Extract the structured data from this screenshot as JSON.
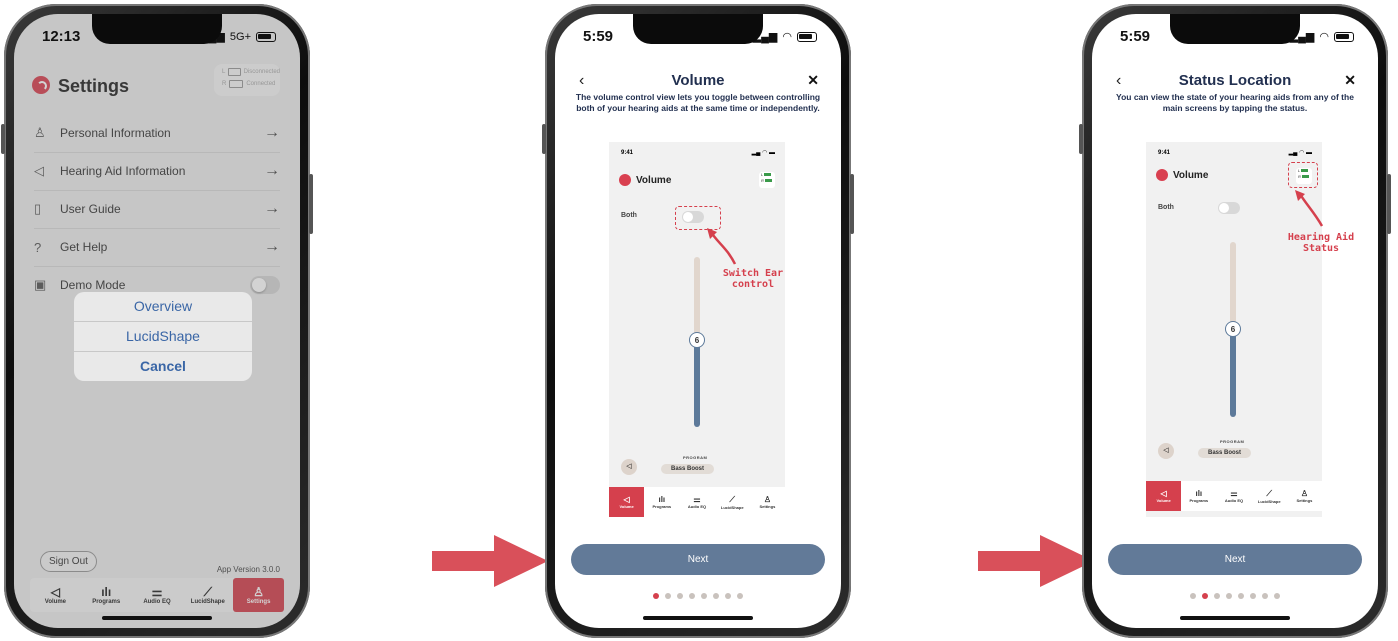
{
  "phone1": {
    "time": "12:13",
    "signal": "5G+",
    "title": "Settings",
    "connection": {
      "left": "L",
      "left_status": "Disconnected",
      "right": "R",
      "right_status": "Connected"
    },
    "menu": [
      {
        "icon": "person-icon",
        "label": "Personal Information"
      },
      {
        "icon": "speaker-icon",
        "label": "Hearing Aid Information"
      },
      {
        "icon": "book-icon",
        "label": "User Guide"
      },
      {
        "icon": "help-icon",
        "label": "Get Help"
      },
      {
        "icon": "demo-icon",
        "label": "Demo Mode"
      }
    ],
    "action_sheet": [
      "Overview",
      "LucidShape",
      "Cancel"
    ],
    "sign_out": "Sign Out",
    "app_version": "App Version 3.0.0",
    "tabs": [
      "Volume",
      "Programs",
      "Audio EQ",
      "LucidShape",
      "Settings"
    ],
    "active_tab": "Settings"
  },
  "phone2": {
    "time": "5:59",
    "title": "Volume",
    "description": "The volume control view lets you toggle between controlling both of your hearing aids at the same time or independently.",
    "mock": {
      "time": "9:41",
      "title": "Volume",
      "left": "L",
      "right": "R",
      "both": "Both",
      "level": "6",
      "program_label": "PROGRAM",
      "program": "Bass Boost",
      "tabs": [
        "Volume",
        "Programs",
        "Audio EQ",
        "LucidShape",
        "Settings"
      ]
    },
    "annotation": "Switch Ear control",
    "next": "Next",
    "page_index": 0,
    "page_count": 8
  },
  "phone3": {
    "time": "5:59",
    "title": "Status Location",
    "description": "You can view the state of your hearing aids from any of the main screens by tapping the status.",
    "mock": {
      "time": "9:41",
      "title": "Volume",
      "left": "L",
      "right": "R",
      "both": "Both",
      "level": "6",
      "program_label": "PROGRAM",
      "program": "Bass Boost",
      "tabs": [
        "Volume",
        "Programs",
        "Audio EQ",
        "LucidShape",
        "Settings"
      ]
    },
    "annotation": "Hearing Aid Status",
    "next": "Next",
    "page_index": 1,
    "page_count": 8
  },
  "colors": {
    "accent": "#d5404d",
    "button": "#627a98",
    "navy": "#223050",
    "arrow": "#d9505a"
  }
}
